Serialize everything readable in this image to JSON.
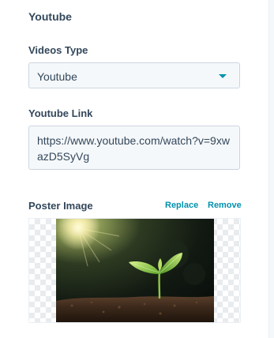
{
  "section": {
    "title": "Youtube"
  },
  "videos_type": {
    "label": "Videos Type",
    "selected": "Youtube",
    "caret_icon": "caret-down-icon",
    "accent": "#0091ae"
  },
  "youtube_link": {
    "label": "Youtube Link",
    "value": "https://www.youtube.com/watch?v=9xwazD5SyVg"
  },
  "poster": {
    "label": "Poster Image",
    "replace_label": "Replace",
    "remove_label": "Remove",
    "image_description_icon": "seedling-in-soil-image",
    "transparency_background": "checkerboard"
  }
}
